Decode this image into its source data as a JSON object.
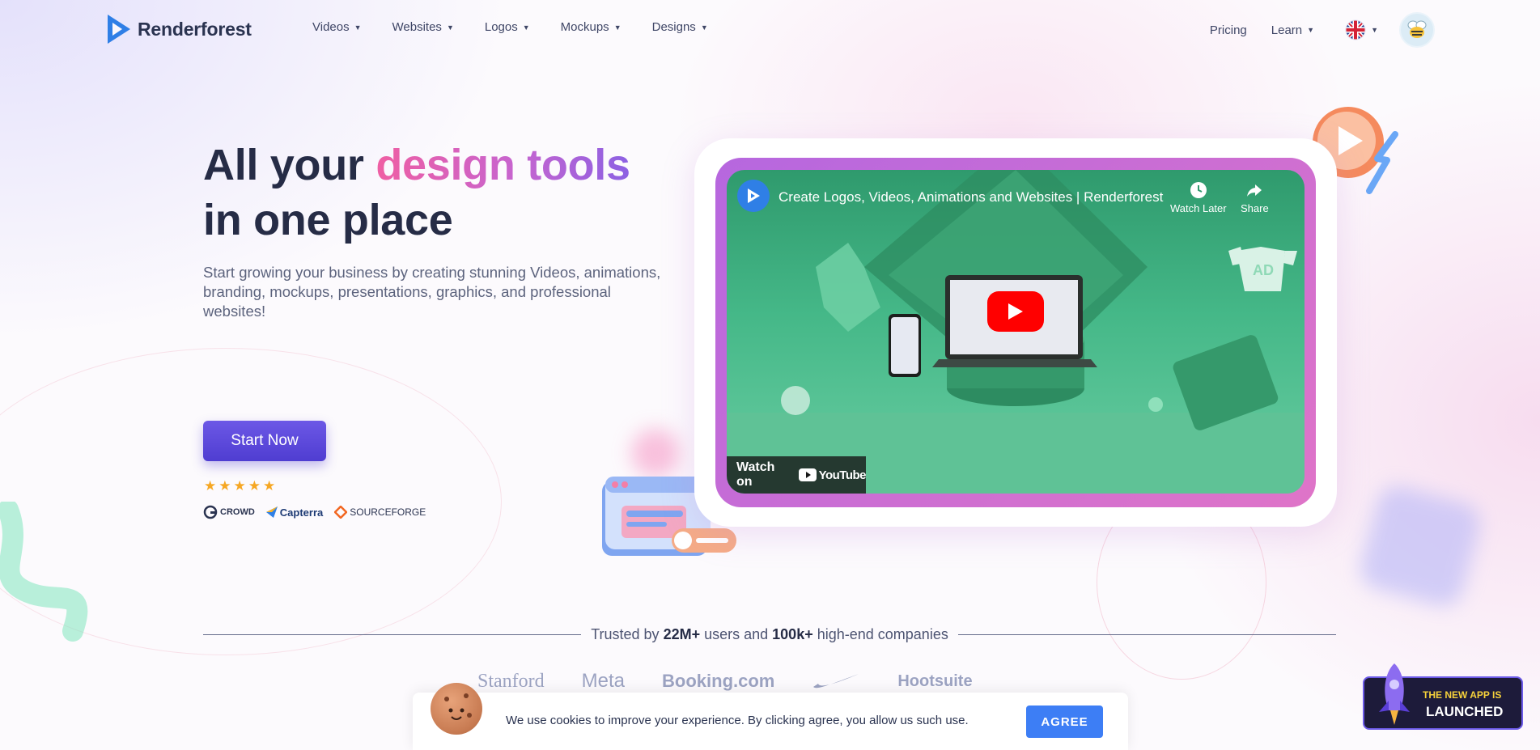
{
  "nav": {
    "brand": "Renderforest",
    "items": [
      {
        "label": "Videos"
      },
      {
        "label": "Websites"
      },
      {
        "label": "Logos"
      },
      {
        "label": "Mockups"
      },
      {
        "label": "Designs"
      }
    ],
    "pricing": "Pricing",
    "learn": "Learn",
    "language_icon": "uk-flag-icon",
    "avatar_icon": "bee-avatar-icon"
  },
  "hero": {
    "title_part1": "All your ",
    "title_highlight": "design tools",
    "title_part2": "in one place",
    "subtitle": "Start growing your business by creating stunning Videos, animations, branding, mockups, presentations, graphics, and professional websites!",
    "cta": "Start Now",
    "rating_stars": 5,
    "review_sites": [
      "CROWD",
      "Capterra",
      "SOURCEFORGE"
    ]
  },
  "video": {
    "title": "Create Logos, Videos, Animations and Websites | Renderforest",
    "watch_later": "Watch Later",
    "share": "Share",
    "watch_on": "Watch on",
    "youtube": "YouTube",
    "shirt_text": "AD"
  },
  "trusted": {
    "prefix": "Trusted by ",
    "users": "22M+",
    "middle": " users and ",
    "companies_count": "100k+",
    "suffix": " high-end companies"
  },
  "companies": [
    "Stanford",
    "Meta",
    "Booking.com",
    "Nike",
    "Hootsuite"
  ],
  "cookie": {
    "text": "We use cookies to improve your experience. By clicking agree, you allow us such use.",
    "button": "AGREE"
  },
  "app_badge": {
    "line1": "THE NEW APP IS",
    "line2": "LAUNCHED"
  },
  "colors": {
    "accent": "#5843d8",
    "cta_blue": "#3d7ef5",
    "title_dark": "#262c46",
    "gradient_start": "#ef5fa3",
    "gradient_end": "#8c61e3",
    "youtube_red": "#ff0000"
  }
}
